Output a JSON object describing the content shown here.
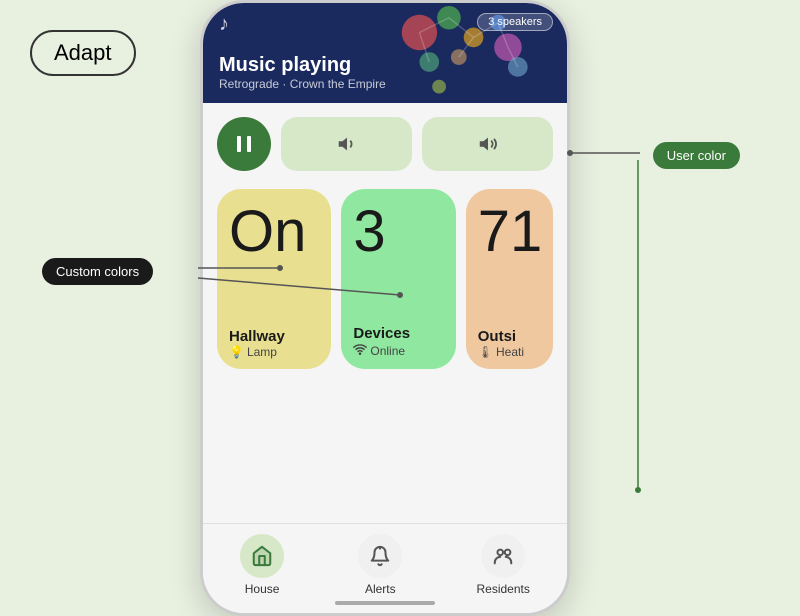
{
  "adapt": {
    "label": "Adapt"
  },
  "music": {
    "badge": "3 speakers",
    "title": "Music playing",
    "subtitle": "Retrograde · Crown the Empire"
  },
  "controls": {
    "pause_icon": "⏸",
    "vol_down_icon": "🔉",
    "vol_up_icon": "🔊"
  },
  "cards": [
    {
      "id": "hallway-lamp",
      "big": "On",
      "label": "Hallway",
      "sublabel": "Lamp",
      "icon": "💡",
      "bg": "#e8e090"
    },
    {
      "id": "devices-online",
      "big": "3",
      "label": "Devices",
      "sublabel": "Online",
      "icon": "wifi",
      "bg": "#90e8a0"
    },
    {
      "id": "outside-heating",
      "big": "71",
      "label": "Outsi",
      "sublabel": "Heati",
      "icon": "🌡",
      "bg": "#f0c8a0"
    }
  ],
  "nav": [
    {
      "id": "house",
      "label": "House",
      "icon": "home"
    },
    {
      "id": "alerts",
      "label": "Alerts",
      "icon": "bell"
    },
    {
      "id": "residents",
      "label": "Residents",
      "icon": "people"
    }
  ],
  "annotations": {
    "user_color": "User color",
    "custom_colors": "Custom colors"
  },
  "colors": {
    "accent_green": "#3a7a3a",
    "card_yellow": "#e8e090",
    "card_green": "#90e8a0",
    "card_orange": "#f0c8a0",
    "bg": "#e8f0e0"
  }
}
